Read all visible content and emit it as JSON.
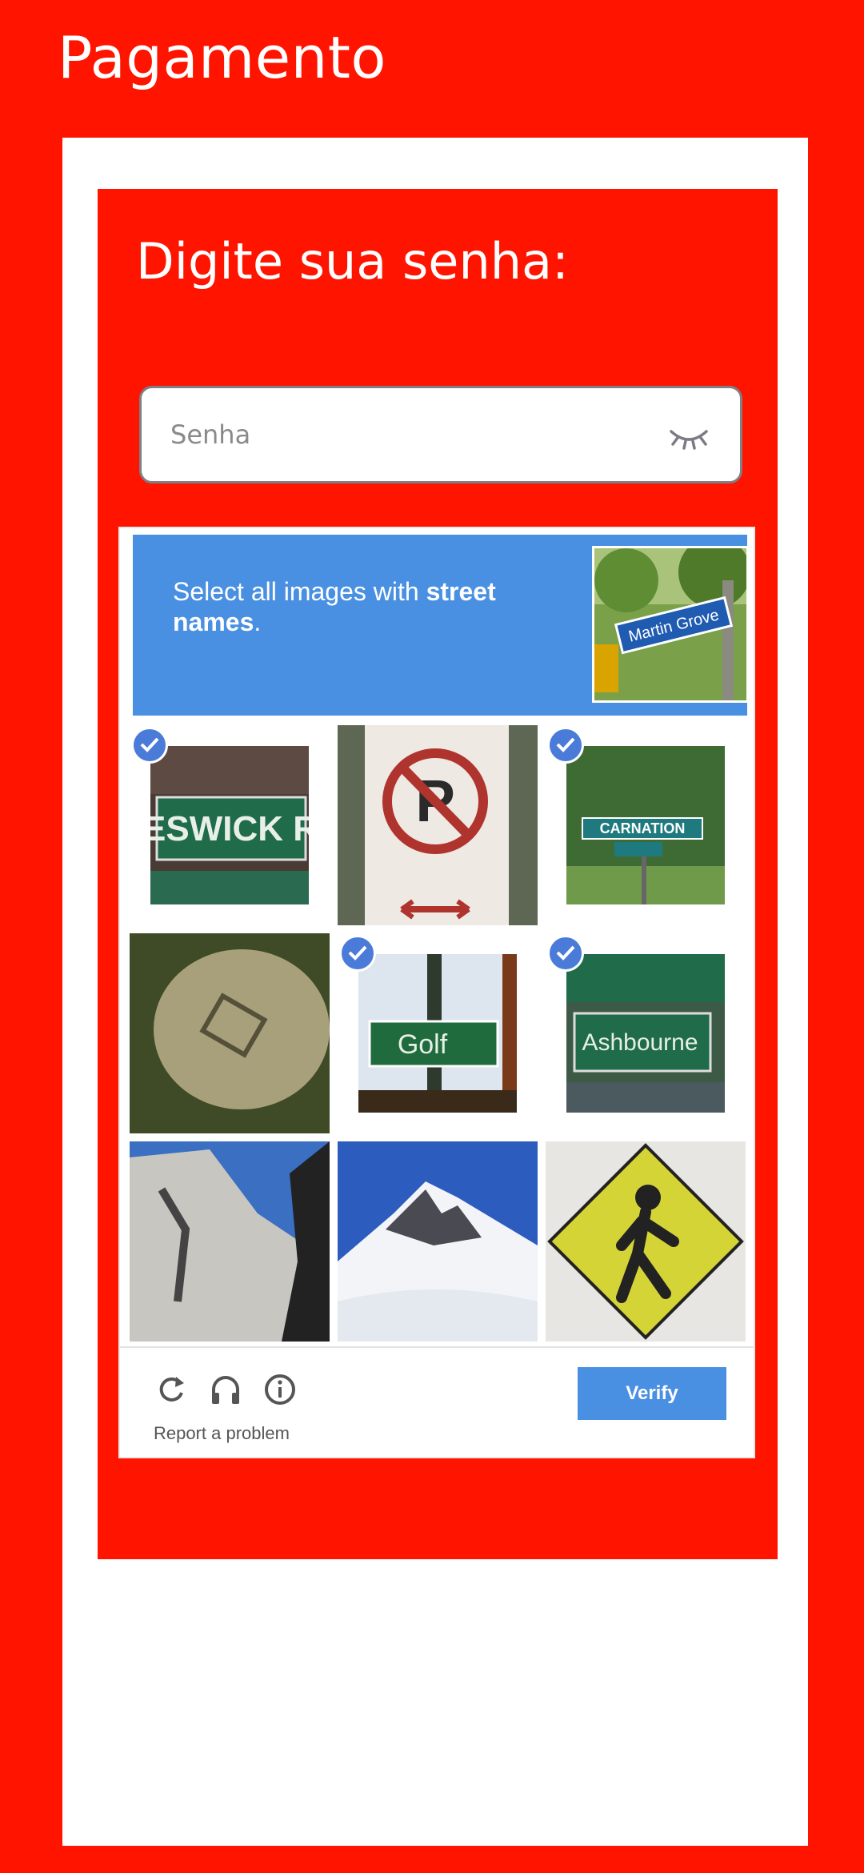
{
  "header": {
    "title": "Pagamento"
  },
  "form": {
    "prompt": "Digite sua senha:",
    "password_placeholder": "Senha",
    "password_value": ""
  },
  "captcha": {
    "instruction_prefix": "Select all images with ",
    "instruction_bold": "street names",
    "instruction_suffix": ".",
    "example_sign_text": "Martin Grove",
    "tiles": [
      {
        "label": "KESWICK RD",
        "selected": true
      },
      {
        "label": "No parking sign",
        "selected": false
      },
      {
        "label": "CARNATION",
        "selected": true
      },
      {
        "label": "Blurry sign",
        "selected": false
      },
      {
        "label": "Golf",
        "selected": true
      },
      {
        "label": "Ashbourne",
        "selected": true
      },
      {
        "label": "Rock cliff",
        "selected": false
      },
      {
        "label": "Snowy mountain",
        "selected": false
      },
      {
        "label": "Pedestrian crossing sign",
        "selected": false
      }
    ],
    "report_label": "Report a problem",
    "verify_label": "Verify"
  },
  "colors": {
    "background": "#ff1400",
    "captcha_blue": "#4a90e2",
    "check_blue": "#4a7bd9"
  }
}
